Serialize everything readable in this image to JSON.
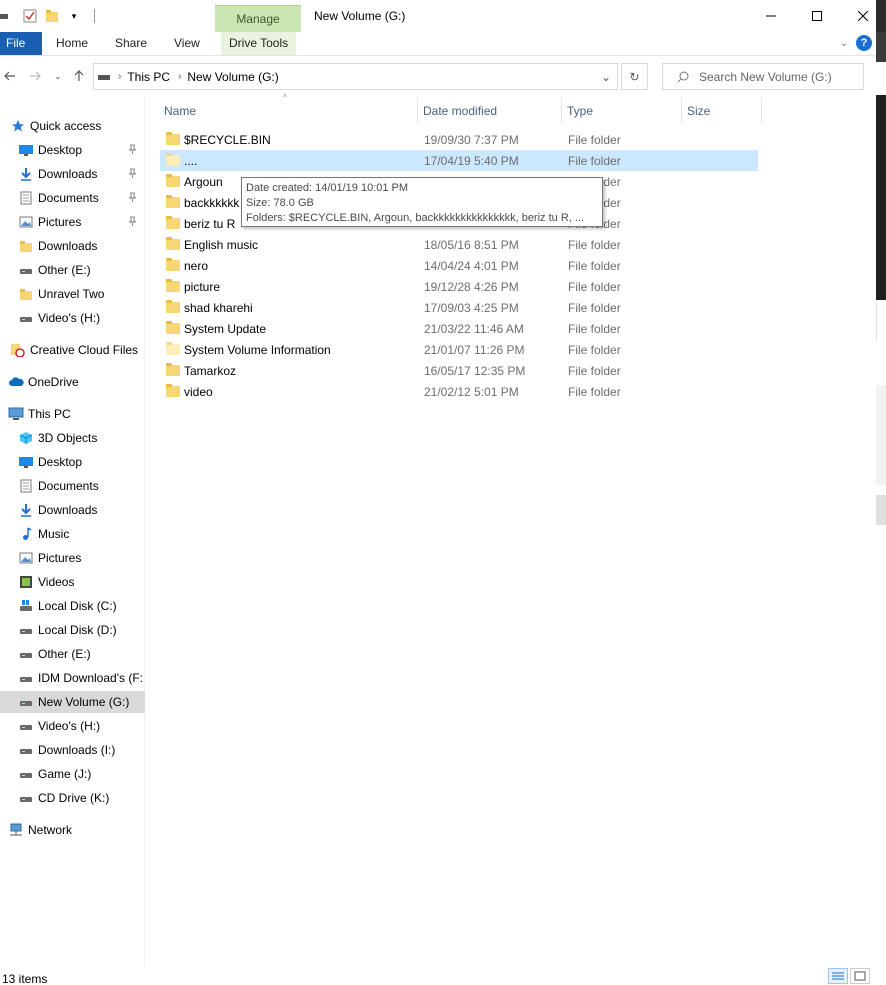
{
  "titlebar": {
    "manage_tab": "Manage",
    "title": "New Volume (G:)"
  },
  "ribbon": {
    "tabs": [
      "File",
      "Home",
      "Share",
      "View",
      "Drive Tools"
    ]
  },
  "address": {
    "crumbs": [
      "This PC",
      "New Volume (G:)"
    ]
  },
  "search": {
    "placeholder": "Search New Volume (G:)"
  },
  "navpane": {
    "items": [
      {
        "label": "Quick access",
        "icon": "star-icon"
      },
      {
        "label": "Desktop",
        "icon": "desktop-icon",
        "pinned": true
      },
      {
        "label": "Downloads",
        "icon": "download-icon",
        "pinned": true
      },
      {
        "label": "Documents",
        "icon": "documents-icon",
        "pinned": true
      },
      {
        "label": "Pictures",
        "icon": "pictures-icon",
        "pinned": true
      },
      {
        "label": "Downloads",
        "icon": "folder-icon"
      },
      {
        "label": "Other (E:)",
        "icon": "drive-icon"
      },
      {
        "label": "Unravel Two",
        "icon": "folder-icon"
      },
      {
        "label": "Video's (H:)",
        "icon": "drive-icon"
      },
      {
        "label": "Creative Cloud Files",
        "icon": "creative-cloud-icon"
      },
      {
        "label": "OneDrive",
        "icon": "cloud-icon"
      },
      {
        "label": "This PC",
        "icon": "computer-icon"
      },
      {
        "label": "3D Objects",
        "icon": "cube-icon"
      },
      {
        "label": "Desktop",
        "icon": "desktop-icon"
      },
      {
        "label": "Documents",
        "icon": "documents-icon"
      },
      {
        "label": "Downloads",
        "icon": "download-icon"
      },
      {
        "label": "Music",
        "icon": "music-icon"
      },
      {
        "label": "Pictures",
        "icon": "pictures-icon"
      },
      {
        "label": "Videos",
        "icon": "video-icon"
      },
      {
        "label": "Local Disk (C:)",
        "icon": "windows-drive-icon"
      },
      {
        "label": "Local Disk (D:)",
        "icon": "drive-icon"
      },
      {
        "label": "Other (E:)",
        "icon": "drive-icon"
      },
      {
        "label": "IDM Download's (F:",
        "icon": "drive-icon"
      },
      {
        "label": "New Volume (G:)",
        "icon": "drive-icon",
        "selected": true
      },
      {
        "label": "Video's (H:)",
        "icon": "drive-icon"
      },
      {
        "label": "Downloads (I:)",
        "icon": "drive-icon"
      },
      {
        "label": "Game (J:)",
        "icon": "drive-icon"
      },
      {
        "label": "CD Drive (K:)",
        "icon": "drive-icon"
      },
      {
        "label": "Network",
        "icon": "network-icon"
      }
    ]
  },
  "columns": [
    "Name",
    "Date modified",
    "Type",
    "Size"
  ],
  "files": [
    {
      "name": "$RECYCLE.BIN",
      "date": "19/09/30 7:37 PM",
      "type": "File folder"
    },
    {
      "name": "....",
      "date": "17/04/19 5:40 PM",
      "type": "File folder",
      "selected": true,
      "pale": true
    },
    {
      "name": "Argoun",
      "date": "",
      "type": "File folder"
    },
    {
      "name": "backkkkkk",
      "date": "",
      "type": "File folder"
    },
    {
      "name": "beriz tu R",
      "date": "",
      "type": "File folder"
    },
    {
      "name": "English music",
      "date": "18/05/16 8:51 PM",
      "type": "File folder"
    },
    {
      "name": "nero",
      "date": "14/04/24 4:01 PM",
      "type": "File folder"
    },
    {
      "name": "picture",
      "date": "19/12/28 4:26 PM",
      "type": "File folder"
    },
    {
      "name": "shad kharehi",
      "date": "17/09/03 4:25 PM",
      "type": "File folder"
    },
    {
      "name": "System Update",
      "date": "21/03/22 11:46 AM",
      "type": "File folder"
    },
    {
      "name": "System Volume Information",
      "date": "21/01/07 11:26 PM",
      "type": "File folder",
      "pale": true
    },
    {
      "name": "Tamarkoz",
      "date": "16/05/17 12:35 PM",
      "type": "File folder"
    },
    {
      "name": "video",
      "date": "21/02/12 5:01 PM",
      "type": "File folder"
    }
  ],
  "tooltip": {
    "line1": "Date created: 14/01/19 10:01 PM",
    "line2": "Size: 78.0 GB",
    "line3": "Folders: $RECYCLE.BIN, Argoun, backkkkkkkkkkkkkkk, beriz tu R, ..."
  },
  "status": {
    "count": "13 items"
  },
  "colors": {
    "file_tab": "#1a5fb4",
    "manage_tab": "#c9e6b3",
    "selection": "#cce8ff",
    "nav_selected": "#d9d9d9",
    "folder": "#f7d774"
  }
}
